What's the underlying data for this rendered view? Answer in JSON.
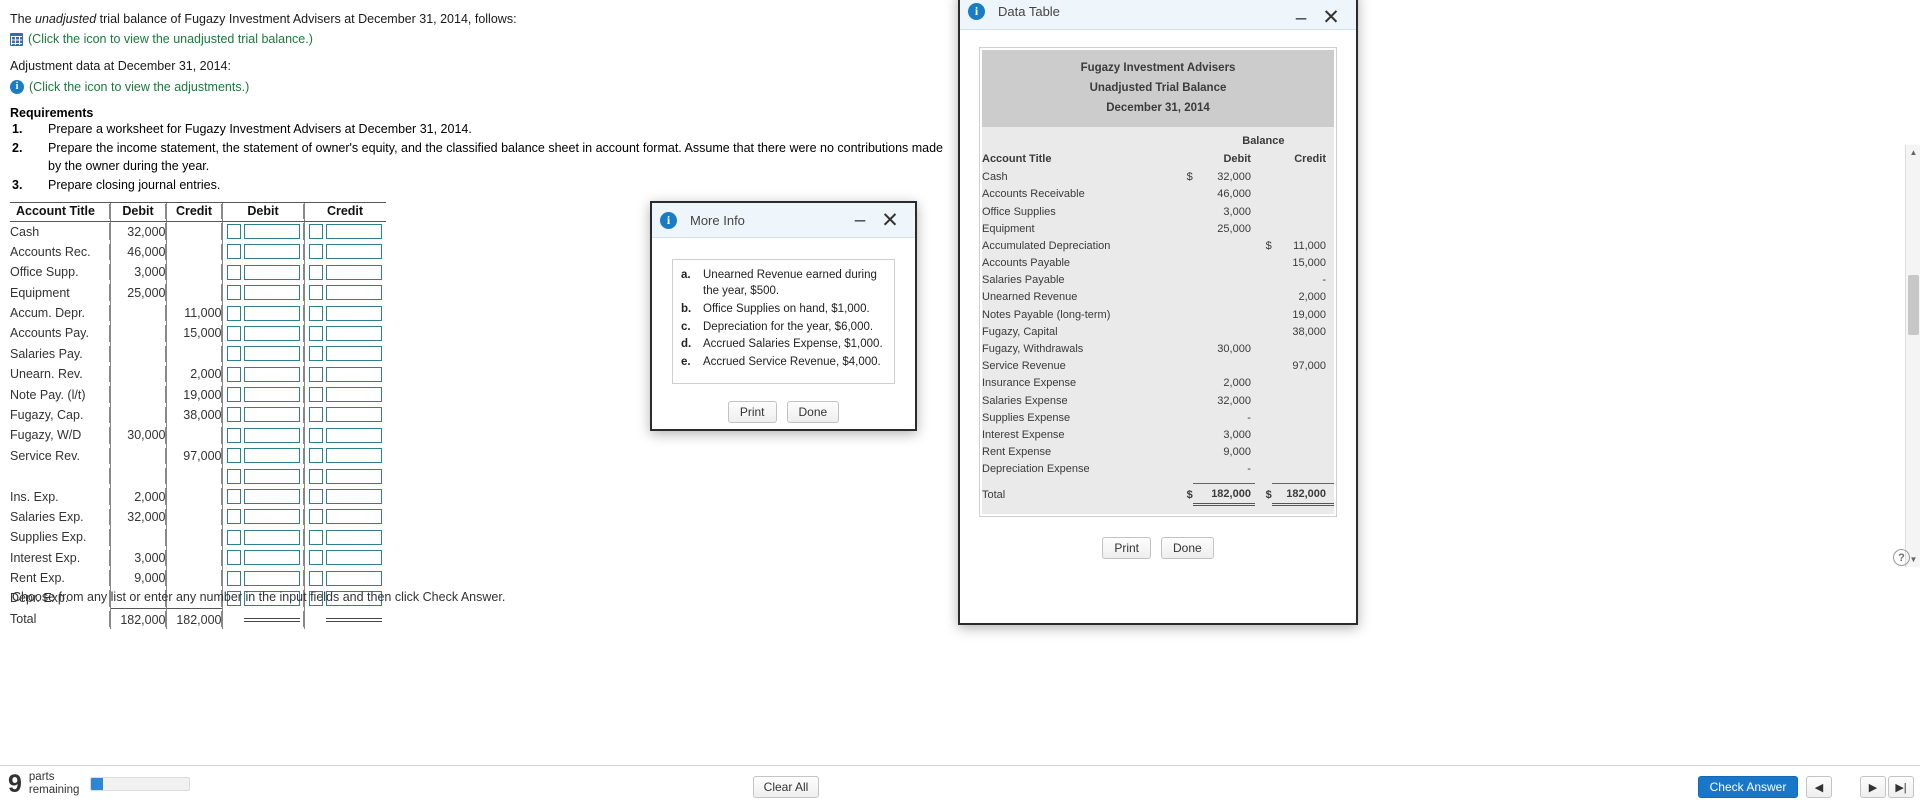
{
  "problem": {
    "intro_pre": "The ",
    "intro_em": "unadjusted",
    "intro_post": " trial balance of Fugazy Investment Advisers at December 31, 2014, follows:",
    "trial_balance_link": "(Click the icon to view the unadjusted trial balance.)",
    "adjustment_label": "Adjustment data at December 31, 2014:",
    "adjustments_link": "(Click the icon to view the adjustments.)",
    "requirements_title": "Requirements",
    "requirements": [
      {
        "num": "1.",
        "text": "Prepare a worksheet for Fugazy Investment Advisers at December 31, 2014."
      },
      {
        "num": "2.",
        "text": "Prepare the income statement, the statement of owner's equity, and the classified balance sheet in account format. Assume that there were no contributions made by the owner during the year."
      },
      {
        "num": "3.",
        "text": "Prepare closing journal entries."
      }
    ],
    "instruction": "Choose from any list or enter any number in the input fields and then click Check Answer."
  },
  "worksheet": {
    "columns": [
      "Account Title",
      "Debit",
      "Credit",
      "Debit",
      "Credit"
    ],
    "rows": [
      {
        "title": "Cash",
        "debit": "32,000",
        "credit": ""
      },
      {
        "title": "Accounts Rec.",
        "debit": "46,000",
        "credit": ""
      },
      {
        "title": "Office Supp.",
        "debit": "3,000",
        "credit": ""
      },
      {
        "title": "Equipment",
        "debit": "25,000",
        "credit": ""
      },
      {
        "title": "Accum. Depr.",
        "debit": "",
        "credit": "11,000"
      },
      {
        "title": "Accounts Pay.",
        "debit": "",
        "credit": "15,000"
      },
      {
        "title": "Salaries Pay.",
        "debit": "",
        "credit": ""
      },
      {
        "title": "Unearn. Rev.",
        "debit": "",
        "credit": "2,000"
      },
      {
        "title": "Note Pay. (l/t)",
        "debit": "",
        "credit": "19,000"
      },
      {
        "title": "Fugazy, Cap.",
        "debit": "",
        "credit": "38,000"
      },
      {
        "title": "Fugazy, W/D",
        "debit": "30,000",
        "credit": ""
      },
      {
        "title": "Service Rev.",
        "debit": "",
        "credit": "97,000"
      },
      {
        "title": "",
        "debit": "",
        "credit": ""
      },
      {
        "title": "Ins. Exp.",
        "debit": "2,000",
        "credit": ""
      },
      {
        "title": "Salaries Exp.",
        "debit": "32,000",
        "credit": ""
      },
      {
        "title": "Supplies Exp.",
        "debit": "",
        "credit": ""
      },
      {
        "title": "Interest Exp.",
        "debit": "3,000",
        "credit": ""
      },
      {
        "title": "Rent Exp.",
        "debit": "9,000",
        "credit": ""
      },
      {
        "title": "Depr. Exp.",
        "debit": "",
        "credit": ""
      }
    ],
    "total": {
      "title": "Total",
      "debit": "182,000",
      "credit": "182,000"
    }
  },
  "more_info_dialog": {
    "title": "More Info",
    "items": [
      {
        "key": "a.",
        "text": "Unearned Revenue earned during the year, $500."
      },
      {
        "key": "b.",
        "text": "Office Supplies on hand, $1,000."
      },
      {
        "key": "c.",
        "text": "Depreciation for the year, $6,000."
      },
      {
        "key": "d.",
        "text": "Accrued Salaries Expense, $1,000."
      },
      {
        "key": "e.",
        "text": "Accrued Service Revenue, $4,000."
      }
    ],
    "print_label": "Print",
    "done_label": "Done",
    "minimize_glyph": "–",
    "close_glyph": "✕"
  },
  "data_table_dialog": {
    "title": "Data Table",
    "company": "Fugazy Investment Advisers",
    "statement": "Unadjusted Trial Balance",
    "date": "December 31, 2014",
    "balance_header": "Balance",
    "col_account": "Account Title",
    "col_debit": "Debit",
    "col_credit": "Credit",
    "rows": [
      {
        "title": "Cash",
        "debit_sym": "$",
        "debit": "32,000",
        "credit_sym": "",
        "credit": ""
      },
      {
        "title": "Accounts Receivable",
        "debit_sym": "",
        "debit": "46,000",
        "credit_sym": "",
        "credit": ""
      },
      {
        "title": "Office Supplies",
        "debit_sym": "",
        "debit": "3,000",
        "credit_sym": "",
        "credit": ""
      },
      {
        "title": "Equipment",
        "debit_sym": "",
        "debit": "25,000",
        "credit_sym": "",
        "credit": ""
      },
      {
        "title": "Accumulated Depreciation",
        "debit_sym": "",
        "debit": "",
        "credit_sym": "$",
        "credit": "11,000"
      },
      {
        "title": "Accounts Payable",
        "debit_sym": "",
        "debit": "",
        "credit_sym": "",
        "credit": "15,000"
      },
      {
        "title": "Salaries Payable",
        "debit_sym": "",
        "debit": "",
        "credit_sym": "",
        "credit": "-"
      },
      {
        "title": "Unearned Revenue",
        "debit_sym": "",
        "debit": "",
        "credit_sym": "",
        "credit": "2,000"
      },
      {
        "title": "Notes Payable (long-term)",
        "debit_sym": "",
        "debit": "",
        "credit_sym": "",
        "credit": "19,000"
      },
      {
        "title": "Fugazy, Capital",
        "debit_sym": "",
        "debit": "",
        "credit_sym": "",
        "credit": "38,000"
      },
      {
        "title": "Fugazy, Withdrawals",
        "debit_sym": "",
        "debit": "30,000",
        "credit_sym": "",
        "credit": ""
      },
      {
        "title": "Service Revenue",
        "debit_sym": "",
        "debit": "",
        "credit_sym": "",
        "credit": "97,000"
      },
      {
        "title": "Insurance Expense",
        "debit_sym": "",
        "debit": "2,000",
        "credit_sym": "",
        "credit": ""
      },
      {
        "title": "Salaries Expense",
        "debit_sym": "",
        "debit": "32,000",
        "credit_sym": "",
        "credit": ""
      },
      {
        "title": "Supplies Expense",
        "debit_sym": "",
        "debit": "-",
        "credit_sym": "",
        "credit": ""
      },
      {
        "title": "Interest Expense",
        "debit_sym": "",
        "debit": "3,000",
        "credit_sym": "",
        "credit": ""
      },
      {
        "title": "Rent Expense",
        "debit_sym": "",
        "debit": "9,000",
        "credit_sym": "",
        "credit": ""
      },
      {
        "title": "Depreciation Expense",
        "debit_sym": "",
        "debit": "-",
        "credit_sym": "",
        "credit": ""
      }
    ],
    "total": {
      "title": "Total",
      "debit_sym": "$",
      "debit": "182,000",
      "credit_sym": "$",
      "credit": "182,000"
    },
    "print_label": "Print",
    "done_label": "Done",
    "minimize_glyph": "–",
    "close_glyph": "✕"
  },
  "bottom_bar": {
    "parts_count": "9",
    "parts_label_line1": "parts",
    "parts_label_line2": "remaining",
    "progress_percent": 12,
    "clear_all_label": "Clear All",
    "check_answer_label": "Check Answer",
    "prev_glyph": "◀",
    "next_glyph": "▶",
    "next2_glyph": "▶|",
    "help_glyph": "?"
  }
}
